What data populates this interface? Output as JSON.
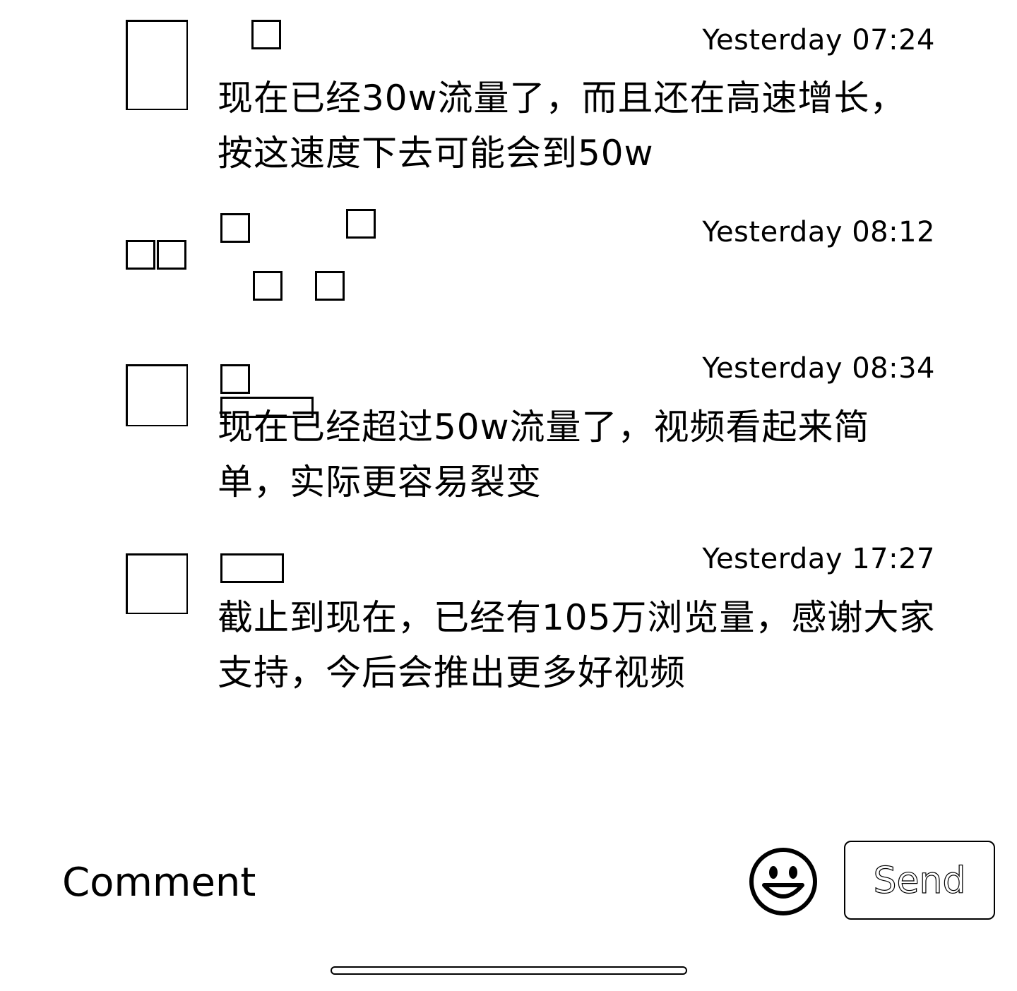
{
  "comments": [
    {
      "time": "Yesterday 07:24",
      "text": "现在已经30w流量了，而且还在高速增长，按这速度下去可能会到50w"
    },
    {
      "time": "Yesterday 08:12",
      "text": ""
    },
    {
      "time": "Yesterday 08:34",
      "text": "现在已经超过50w流量了，视频看起来简单，实际更容易裂变"
    },
    {
      "time": "Yesterday 17:27",
      "text": "截止到现在，已经有105万浏览量，感谢大家支持，今后会推出更多好视频"
    }
  ],
  "composer": {
    "placeholder": "Comment",
    "emoji_icon": "smiley-face-icon",
    "send_label": "Send"
  },
  "colors": {
    "text": "#000000",
    "background": "#ffffff"
  }
}
